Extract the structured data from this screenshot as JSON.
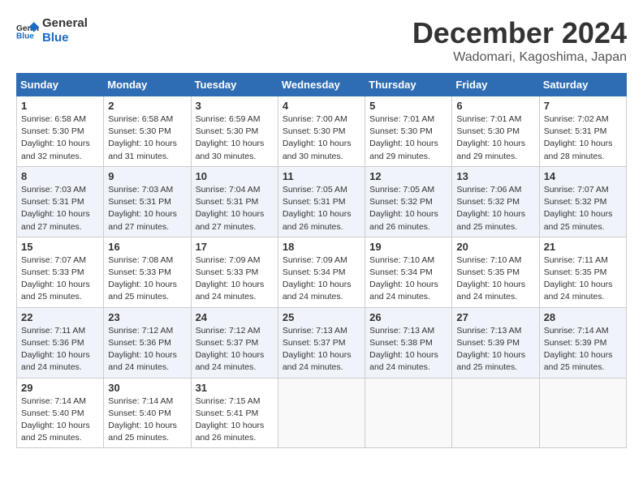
{
  "logo": {
    "line1": "General",
    "line2": "Blue"
  },
  "title": "December 2024",
  "location": "Wadomari, Kagoshima, Japan",
  "weekdays": [
    "Sunday",
    "Monday",
    "Tuesday",
    "Wednesday",
    "Thursday",
    "Friday",
    "Saturday"
  ],
  "weeks": [
    [
      {
        "day": "1",
        "sunrise": "6:58 AM",
        "sunset": "5:30 PM",
        "daylight": "10 hours and 32 minutes."
      },
      {
        "day": "2",
        "sunrise": "6:58 AM",
        "sunset": "5:30 PM",
        "daylight": "10 hours and 31 minutes."
      },
      {
        "day": "3",
        "sunrise": "6:59 AM",
        "sunset": "5:30 PM",
        "daylight": "10 hours and 30 minutes."
      },
      {
        "day": "4",
        "sunrise": "7:00 AM",
        "sunset": "5:30 PM",
        "daylight": "10 hours and 30 minutes."
      },
      {
        "day": "5",
        "sunrise": "7:01 AM",
        "sunset": "5:30 PM",
        "daylight": "10 hours and 29 minutes."
      },
      {
        "day": "6",
        "sunrise": "7:01 AM",
        "sunset": "5:30 PM",
        "daylight": "10 hours and 29 minutes."
      },
      {
        "day": "7",
        "sunrise": "7:02 AM",
        "sunset": "5:31 PM",
        "daylight": "10 hours and 28 minutes."
      }
    ],
    [
      {
        "day": "8",
        "sunrise": "7:03 AM",
        "sunset": "5:31 PM",
        "daylight": "10 hours and 27 minutes."
      },
      {
        "day": "9",
        "sunrise": "7:03 AM",
        "sunset": "5:31 PM",
        "daylight": "10 hours and 27 minutes."
      },
      {
        "day": "10",
        "sunrise": "7:04 AM",
        "sunset": "5:31 PM",
        "daylight": "10 hours and 27 minutes."
      },
      {
        "day": "11",
        "sunrise": "7:05 AM",
        "sunset": "5:31 PM",
        "daylight": "10 hours and 26 minutes."
      },
      {
        "day": "12",
        "sunrise": "7:05 AM",
        "sunset": "5:32 PM",
        "daylight": "10 hours and 26 minutes."
      },
      {
        "day": "13",
        "sunrise": "7:06 AM",
        "sunset": "5:32 PM",
        "daylight": "10 hours and 25 minutes."
      },
      {
        "day": "14",
        "sunrise": "7:07 AM",
        "sunset": "5:32 PM",
        "daylight": "10 hours and 25 minutes."
      }
    ],
    [
      {
        "day": "15",
        "sunrise": "7:07 AM",
        "sunset": "5:33 PM",
        "daylight": "10 hours and 25 minutes."
      },
      {
        "day": "16",
        "sunrise": "7:08 AM",
        "sunset": "5:33 PM",
        "daylight": "10 hours and 25 minutes."
      },
      {
        "day": "17",
        "sunrise": "7:09 AM",
        "sunset": "5:33 PM",
        "daylight": "10 hours and 24 minutes."
      },
      {
        "day": "18",
        "sunrise": "7:09 AM",
        "sunset": "5:34 PM",
        "daylight": "10 hours and 24 minutes."
      },
      {
        "day": "19",
        "sunrise": "7:10 AM",
        "sunset": "5:34 PM",
        "daylight": "10 hours and 24 minutes."
      },
      {
        "day": "20",
        "sunrise": "7:10 AM",
        "sunset": "5:35 PM",
        "daylight": "10 hours and 24 minutes."
      },
      {
        "day": "21",
        "sunrise": "7:11 AM",
        "sunset": "5:35 PM",
        "daylight": "10 hours and 24 minutes."
      }
    ],
    [
      {
        "day": "22",
        "sunrise": "7:11 AM",
        "sunset": "5:36 PM",
        "daylight": "10 hours and 24 minutes."
      },
      {
        "day": "23",
        "sunrise": "7:12 AM",
        "sunset": "5:36 PM",
        "daylight": "10 hours and 24 minutes."
      },
      {
        "day": "24",
        "sunrise": "7:12 AM",
        "sunset": "5:37 PM",
        "daylight": "10 hours and 24 minutes."
      },
      {
        "day": "25",
        "sunrise": "7:13 AM",
        "sunset": "5:37 PM",
        "daylight": "10 hours and 24 minutes."
      },
      {
        "day": "26",
        "sunrise": "7:13 AM",
        "sunset": "5:38 PM",
        "daylight": "10 hours and 24 minutes."
      },
      {
        "day": "27",
        "sunrise": "7:13 AM",
        "sunset": "5:39 PM",
        "daylight": "10 hours and 25 minutes."
      },
      {
        "day": "28",
        "sunrise": "7:14 AM",
        "sunset": "5:39 PM",
        "daylight": "10 hours and 25 minutes."
      }
    ],
    [
      {
        "day": "29",
        "sunrise": "7:14 AM",
        "sunset": "5:40 PM",
        "daylight": "10 hours and 25 minutes."
      },
      {
        "day": "30",
        "sunrise": "7:14 AM",
        "sunset": "5:40 PM",
        "daylight": "10 hours and 25 minutes."
      },
      {
        "day": "31",
        "sunrise": "7:15 AM",
        "sunset": "5:41 PM",
        "daylight": "10 hours and 26 minutes."
      },
      null,
      null,
      null,
      null
    ]
  ]
}
